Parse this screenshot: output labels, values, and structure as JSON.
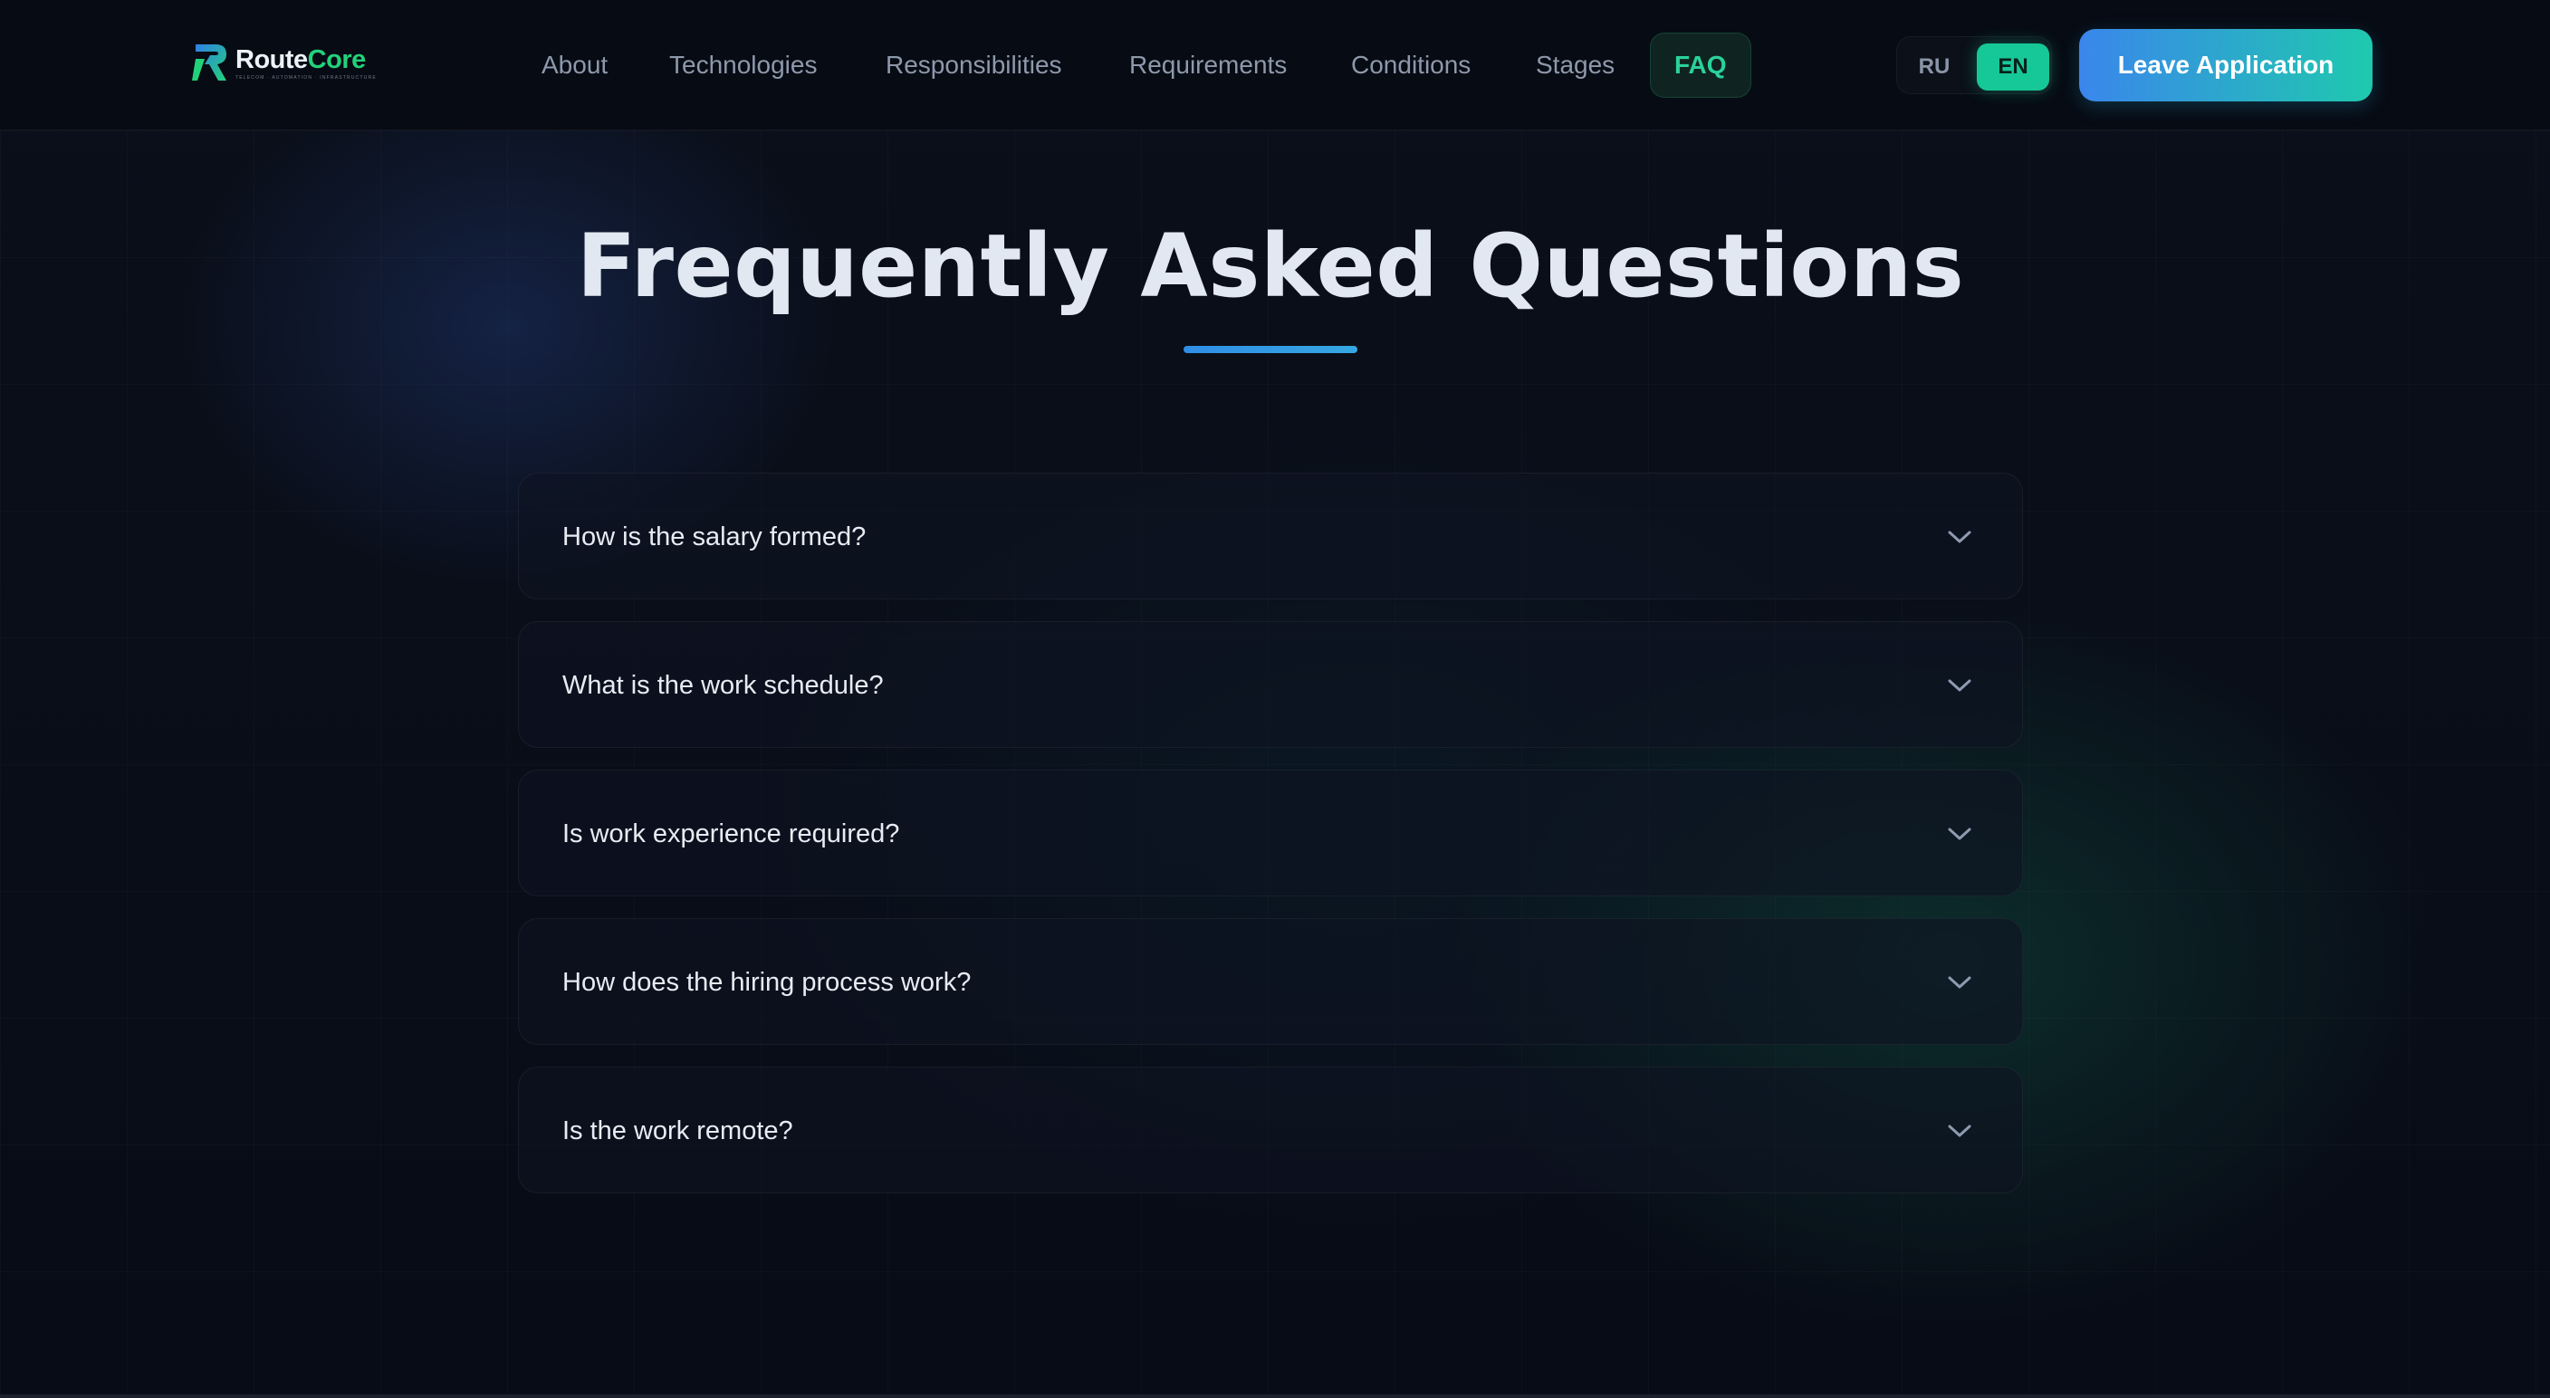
{
  "brand": {
    "name_part1": "Route",
    "name_part2": "Core",
    "tagline": "TELECOM · AUTOMATION · INFRASTRUCTURE",
    "accent_color": "#22d27a"
  },
  "nav": {
    "items": [
      {
        "label": "About"
      },
      {
        "label": "Technologies"
      },
      {
        "label": "Responsibilities"
      },
      {
        "label": "Requirements"
      },
      {
        "label": "Conditions"
      },
      {
        "label": "Stages"
      },
      {
        "label": "FAQ",
        "active": true
      }
    ]
  },
  "language": {
    "options": [
      "RU",
      "EN"
    ],
    "selected": "EN"
  },
  "cta": {
    "label": "Leave Application"
  },
  "faq": {
    "title": "Frequently Asked Questions",
    "items": [
      {
        "question": "How is the salary formed?",
        "expanded": false
      },
      {
        "question": "What is the work schedule?",
        "expanded": false
      },
      {
        "question": "Is work experience required?",
        "expanded": false
      },
      {
        "question": "How does the hiring process work?",
        "expanded": false
      },
      {
        "question": "Is the work remote?",
        "expanded": false
      }
    ],
    "chevron_icon": "chevron-down-icon"
  },
  "colors": {
    "background": "#080c16",
    "active_nav": "#2ad29a",
    "cta_gradient_start": "#3a86ec",
    "cta_gradient_end": "#1fc9ae",
    "title": "#e2e8f1"
  }
}
